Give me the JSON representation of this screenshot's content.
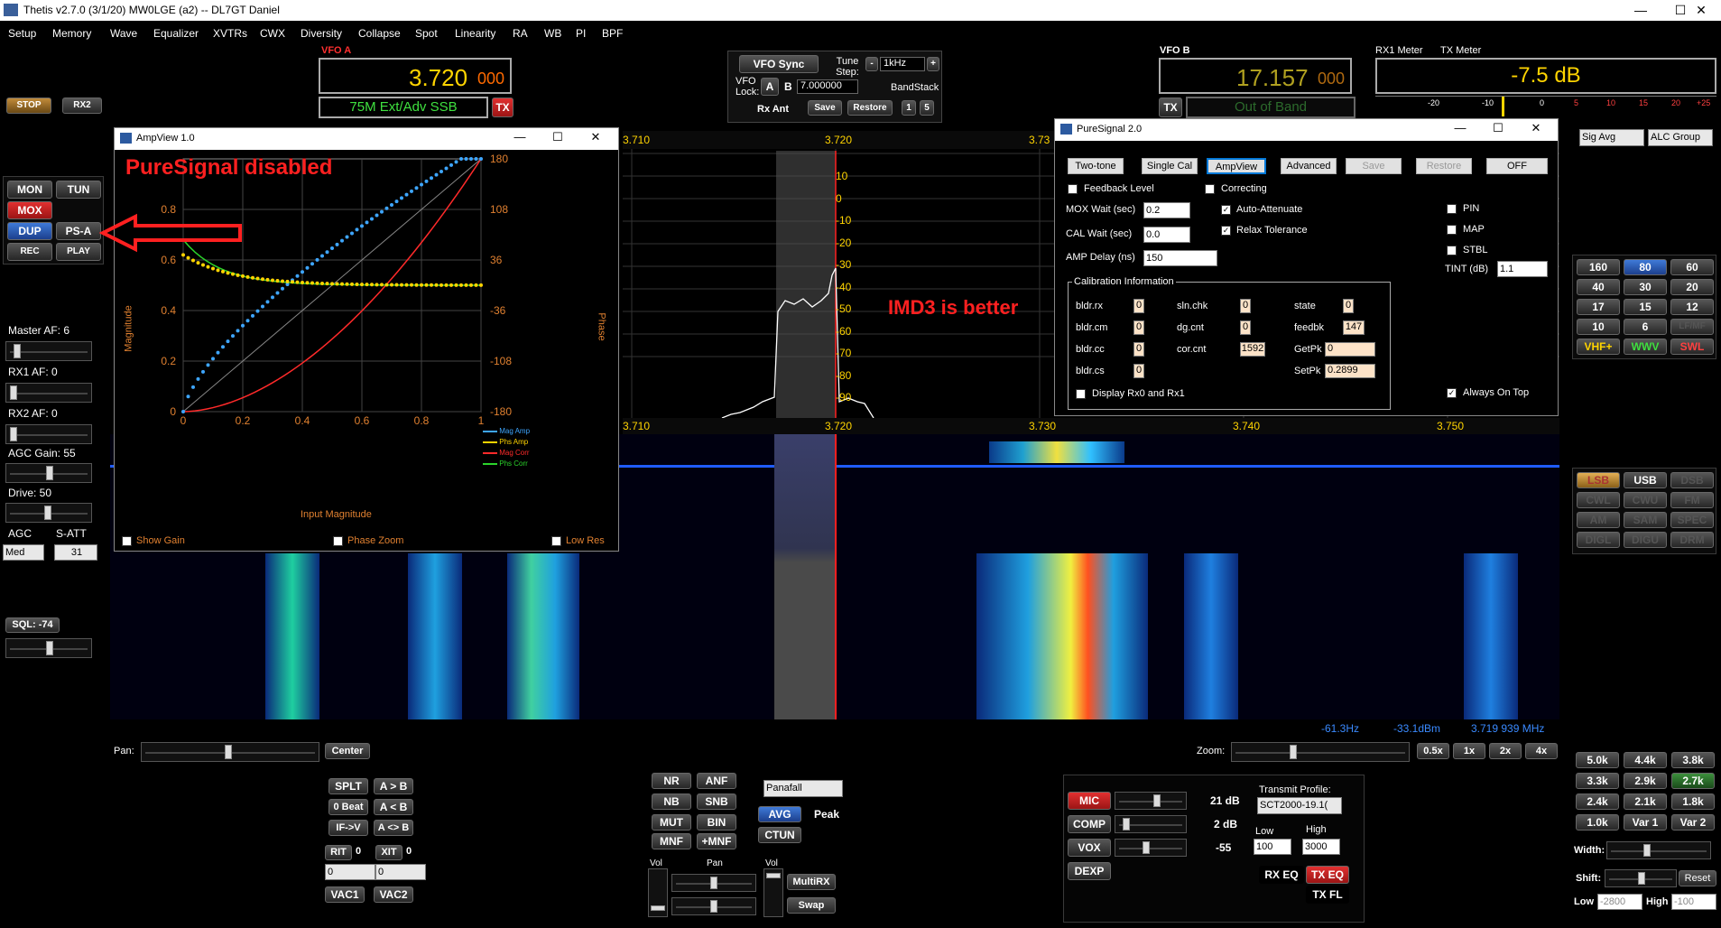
{
  "window": {
    "title": "Thetis v2.7.0 (3/1/20) MW0LGE (a2)  --  DL7GT Daniel",
    "min": "—",
    "max": "☐",
    "close": "✕"
  },
  "menu": [
    "Setup",
    "Memory",
    "Wave",
    "Equalizer",
    "XVTRs",
    "CWX",
    "Diversity",
    "Collapse",
    "Spot",
    "Linearity",
    "RA",
    "WB",
    "PI",
    "BPF"
  ],
  "left": {
    "stop": "STOP",
    "rx2": "RX2",
    "mon": "MON",
    "tun": "TUN",
    "mox": "MOX",
    "dup": "DUP",
    "psa": "PS-A",
    "rec": "REC",
    "play": "PLAY",
    "master_af": "Master AF:  6",
    "rx1_af": "RX1 AF:  0",
    "rx2_af": "RX2 AF:  0",
    "agc_gain": "AGC Gain:  55",
    "drive": "Drive:  50",
    "agc": "AGC",
    "satt": "S-ATT",
    "agc_mode": "Med",
    "satt_val": "31",
    "sql": "SQL: -74"
  },
  "vfoa": {
    "label": "VFO A",
    "freq": "3.720",
    "sub": "000",
    "band": "75M Ext/Adv SSB",
    "tx": "TX"
  },
  "vfob": {
    "label": "VFO B",
    "freq": "17.157",
    "sub": "000",
    "band": "Out of Band",
    "tx": "TX"
  },
  "vfoctl": {
    "sync": "VFO Sync",
    "tune_step": "Tune Step:",
    "step_val": "1kHz",
    "vfo_lock": "VFO Lock:",
    "a": "A",
    "b": "B",
    "val": "7.000000",
    "bandstack": "BandStack",
    "rx_ant": "Rx Ant",
    "save": "Save",
    "restore": "Restore",
    "one": "1",
    "five": "5"
  },
  "meter": {
    "rx1": "RX1 Meter",
    "tx": "TX Meter",
    "value": "-7.5 dB",
    "ticks": [
      "-20",
      "-10",
      "0",
      "5",
      "10",
      "15",
      "20",
      "+25"
    ]
  },
  "ampview": {
    "title": "AmpView 1.0",
    "annotation": "PureSignal disabled",
    "xlabel": "Input Magnitude",
    "ylabel_l": "Magnitude",
    "ylabel_r": "Phase",
    "xticks": [
      "0",
      "0.2",
      "0.4",
      "0.6",
      "0.8",
      "1"
    ],
    "yticks_l": [
      "0",
      "0.2",
      "0.4",
      "0.6",
      "0.8"
    ],
    "yticks_r": [
      "180",
      "108",
      "36",
      "-36",
      "-108",
      "-180"
    ],
    "legend": [
      "Mag Amp",
      "Phs Amp",
      "Mag Corr",
      "Phs Corr"
    ],
    "legend_colors": [
      "#3ea6ff",
      "#ffd400",
      "#ff2a2a",
      "#2bd42b"
    ],
    "show_gain": "Show Gain",
    "phase_zoom": "Phase Zoom",
    "low_res": "Low Res"
  },
  "spectrum": {
    "top_ticks": [
      "3.710",
      "3.720",
      "3.73"
    ],
    "bottom_ticks": [
      "3.710",
      "3.720",
      "3.730",
      "3.740",
      "3.750"
    ],
    "db_ticks": [
      "10",
      "0",
      "-10",
      "-20",
      "-30",
      "-40",
      "-50",
      "-60",
      "-70",
      "-80",
      "-90"
    ],
    "annotation": "IMD3 is better",
    "readout_hz": "-61.3Hz",
    "readout_dbm": "-33.1dBm",
    "readout_mhz": "3.719 939 MHz"
  },
  "ps": {
    "title": "PureSignal 2.0",
    "two_tone": "Two-tone",
    "single_cal": "Single Cal",
    "ampview": "AmpView",
    "advanced": "Advanced",
    "save": "Save",
    "restore": "Restore",
    "off": "OFF",
    "feedback": "Feedback Level",
    "correcting": "Correcting",
    "mox_wait": "MOX Wait (sec)",
    "mox_val": "0.2",
    "auto_att": "Auto-Attenuate",
    "cal_wait": "CAL Wait (sec)",
    "cal_val": "0.0",
    "relax": "Relax Tolerance",
    "amp_delay": "AMP Delay (ns)",
    "amp_val": "150",
    "pin": "PIN",
    "map": "MAP",
    "stbl": "STBL",
    "tint": "TINT (dB)",
    "tint_val": "1.1",
    "calib": "Calibration Information",
    "bldr_rx": "bldr.rx",
    "bldr_cm": "bldr.cm",
    "bldr_cc": "bldr.cc",
    "bldr_cs": "bldr.cs",
    "sln": "sln.chk",
    "dg": "dg.cnt",
    "cor": "cor.cnt",
    "state": "state",
    "feedbk": "feedbk",
    "getpk": "GetPk",
    "setpk": "SetPk",
    "v_rx": "0",
    "v_cm": "0",
    "v_cc": "0",
    "v_cs": "0",
    "v_sln": "0",
    "v_dg": "0",
    "v_cor": "1592",
    "v_state": "0",
    "v_feedbk": "147",
    "v_getpk": "0",
    "v_setpk": "0.2899",
    "display": "Display Rx0 and Rx1",
    "always": "Always On Top"
  },
  "right": {
    "sig_avg": "Sig Avg",
    "alc": "ALC Group",
    "bands": [
      "160",
      "80",
      "60",
      "40",
      "30",
      "20",
      "17",
      "15",
      "12",
      "10",
      "6",
      "LF/MF",
      "VHF+",
      "WWV",
      "SWL"
    ],
    "modes": [
      "LSB",
      "USB",
      "DSB",
      "CWL",
      "CWU",
      "FM",
      "AM",
      "SAM",
      "SPEC",
      "DIGL",
      "DIGU",
      "DRM"
    ],
    "filters": [
      "5.0k",
      "4.4k",
      "3.8k",
      "3.3k",
      "2.9k",
      "2.7k",
      "2.4k",
      "2.1k",
      "1.8k",
      "1.0k",
      "Var 1",
      "Var 2"
    ],
    "width": "Width:",
    "shift": "Shift:",
    "reset": "Reset",
    "low": "Low",
    "high": "High",
    "low_val": "-2800",
    "high_val": "-100"
  },
  "bottom": {
    "pan": "Pan:",
    "center": "Center",
    "zoom": "Zoom:",
    "z05": "0.5x",
    "z1": "1x",
    "z2": "2x",
    "z4": "4x",
    "splt": "SPLT",
    "ab": "A > B",
    "zbeat": "0 Beat",
    "ba": "A < B",
    "ifv": "IF->V",
    "aswap": "A <> B",
    "rit": "RIT",
    "rit_v": "0",
    "xit": "XIT",
    "xit_v": "0",
    "rit_in": "0",
    "xit_in": "0",
    "vac1": "VAC1",
    "vac2": "VAC2",
    "nr": "NR",
    "anf": "ANF",
    "nb": "NB",
    "snb": "SNB",
    "mut": "MUT",
    "bin": "BIN",
    "mnf": "MNF",
    "pmnf": "+MNF",
    "panafall": "Panafall",
    "avg": "AVG",
    "peak": "Peak",
    "ctun": "CTUN",
    "vol": "Vol",
    "pan2": "Pan",
    "vol2": "Vol",
    "multirx": "MultiRX",
    "swap": "Swap",
    "mic": "MIC",
    "mic_v": "21 dB",
    "comp": "COMP",
    "comp_v": "2 dB",
    "vox": "VOX",
    "vox_v": "-55",
    "dexp": "DEXP",
    "txprof": "Transmit Profile:",
    "txprof_v": "SCT2000-19.1(",
    "low": "Low",
    "high": "High",
    "low_v": "100",
    "high_v": "3000",
    "rxeq": "RX EQ",
    "txeq": "TX EQ",
    "txfl": "TX FL"
  }
}
